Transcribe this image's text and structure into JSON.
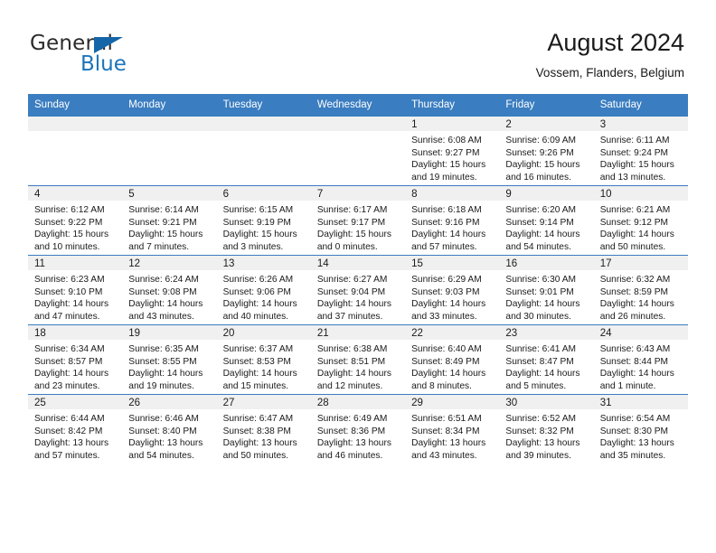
{
  "brand": {
    "name_part1": "General",
    "name_part2": "Blue",
    "triangle_color": "#1566a8",
    "blue_color": "#1b75bb"
  },
  "header": {
    "title": "August 2024",
    "subtitle": "Vossem, Flanders, Belgium"
  },
  "theme": {
    "header_row_bg": "#3a7dc0",
    "header_row_text": "#ffffff",
    "daynum_band_bg": "#f0f0f0",
    "grid_line": "#3a7dc0",
    "body_text": "#1a1a1a"
  },
  "weekday_headers": [
    "Sunday",
    "Monday",
    "Tuesday",
    "Wednesday",
    "Thursday",
    "Friday",
    "Saturday"
  ],
  "weeks": [
    [
      {
        "day": "",
        "lines": []
      },
      {
        "day": "",
        "lines": []
      },
      {
        "day": "",
        "lines": []
      },
      {
        "day": "",
        "lines": []
      },
      {
        "day": "1",
        "lines": [
          "Sunrise: 6:08 AM",
          "Sunset: 9:27 PM",
          "Daylight: 15 hours",
          "and 19 minutes."
        ]
      },
      {
        "day": "2",
        "lines": [
          "Sunrise: 6:09 AM",
          "Sunset: 9:26 PM",
          "Daylight: 15 hours",
          "and 16 minutes."
        ]
      },
      {
        "day": "3",
        "lines": [
          "Sunrise: 6:11 AM",
          "Sunset: 9:24 PM",
          "Daylight: 15 hours",
          "and 13 minutes."
        ]
      }
    ],
    [
      {
        "day": "4",
        "lines": [
          "Sunrise: 6:12 AM",
          "Sunset: 9:22 PM",
          "Daylight: 15 hours",
          "and 10 minutes."
        ]
      },
      {
        "day": "5",
        "lines": [
          "Sunrise: 6:14 AM",
          "Sunset: 9:21 PM",
          "Daylight: 15 hours",
          "and 7 minutes."
        ]
      },
      {
        "day": "6",
        "lines": [
          "Sunrise: 6:15 AM",
          "Sunset: 9:19 PM",
          "Daylight: 15 hours",
          "and 3 minutes."
        ]
      },
      {
        "day": "7",
        "lines": [
          "Sunrise: 6:17 AM",
          "Sunset: 9:17 PM",
          "Daylight: 15 hours",
          "and 0 minutes."
        ]
      },
      {
        "day": "8",
        "lines": [
          "Sunrise: 6:18 AM",
          "Sunset: 9:16 PM",
          "Daylight: 14 hours",
          "and 57 minutes."
        ]
      },
      {
        "day": "9",
        "lines": [
          "Sunrise: 6:20 AM",
          "Sunset: 9:14 PM",
          "Daylight: 14 hours",
          "and 54 minutes."
        ]
      },
      {
        "day": "10",
        "lines": [
          "Sunrise: 6:21 AM",
          "Sunset: 9:12 PM",
          "Daylight: 14 hours",
          "and 50 minutes."
        ]
      }
    ],
    [
      {
        "day": "11",
        "lines": [
          "Sunrise: 6:23 AM",
          "Sunset: 9:10 PM",
          "Daylight: 14 hours",
          "and 47 minutes."
        ]
      },
      {
        "day": "12",
        "lines": [
          "Sunrise: 6:24 AM",
          "Sunset: 9:08 PM",
          "Daylight: 14 hours",
          "and 43 minutes."
        ]
      },
      {
        "day": "13",
        "lines": [
          "Sunrise: 6:26 AM",
          "Sunset: 9:06 PM",
          "Daylight: 14 hours",
          "and 40 minutes."
        ]
      },
      {
        "day": "14",
        "lines": [
          "Sunrise: 6:27 AM",
          "Sunset: 9:04 PM",
          "Daylight: 14 hours",
          "and 37 minutes."
        ]
      },
      {
        "day": "15",
        "lines": [
          "Sunrise: 6:29 AM",
          "Sunset: 9:03 PM",
          "Daylight: 14 hours",
          "and 33 minutes."
        ]
      },
      {
        "day": "16",
        "lines": [
          "Sunrise: 6:30 AM",
          "Sunset: 9:01 PM",
          "Daylight: 14 hours",
          "and 30 minutes."
        ]
      },
      {
        "day": "17",
        "lines": [
          "Sunrise: 6:32 AM",
          "Sunset: 8:59 PM",
          "Daylight: 14 hours",
          "and 26 minutes."
        ]
      }
    ],
    [
      {
        "day": "18",
        "lines": [
          "Sunrise: 6:34 AM",
          "Sunset: 8:57 PM",
          "Daylight: 14 hours",
          "and 23 minutes."
        ]
      },
      {
        "day": "19",
        "lines": [
          "Sunrise: 6:35 AM",
          "Sunset: 8:55 PM",
          "Daylight: 14 hours",
          "and 19 minutes."
        ]
      },
      {
        "day": "20",
        "lines": [
          "Sunrise: 6:37 AM",
          "Sunset: 8:53 PM",
          "Daylight: 14 hours",
          "and 15 minutes."
        ]
      },
      {
        "day": "21",
        "lines": [
          "Sunrise: 6:38 AM",
          "Sunset: 8:51 PM",
          "Daylight: 14 hours",
          "and 12 minutes."
        ]
      },
      {
        "day": "22",
        "lines": [
          "Sunrise: 6:40 AM",
          "Sunset: 8:49 PM",
          "Daylight: 14 hours",
          "and 8 minutes."
        ]
      },
      {
        "day": "23",
        "lines": [
          "Sunrise: 6:41 AM",
          "Sunset: 8:47 PM",
          "Daylight: 14 hours",
          "and 5 minutes."
        ]
      },
      {
        "day": "24",
        "lines": [
          "Sunrise: 6:43 AM",
          "Sunset: 8:44 PM",
          "Daylight: 14 hours",
          "and 1 minute."
        ]
      }
    ],
    [
      {
        "day": "25",
        "lines": [
          "Sunrise: 6:44 AM",
          "Sunset: 8:42 PM",
          "Daylight: 13 hours",
          "and 57 minutes."
        ]
      },
      {
        "day": "26",
        "lines": [
          "Sunrise: 6:46 AM",
          "Sunset: 8:40 PM",
          "Daylight: 13 hours",
          "and 54 minutes."
        ]
      },
      {
        "day": "27",
        "lines": [
          "Sunrise: 6:47 AM",
          "Sunset: 8:38 PM",
          "Daylight: 13 hours",
          "and 50 minutes."
        ]
      },
      {
        "day": "28",
        "lines": [
          "Sunrise: 6:49 AM",
          "Sunset: 8:36 PM",
          "Daylight: 13 hours",
          "and 46 minutes."
        ]
      },
      {
        "day": "29",
        "lines": [
          "Sunrise: 6:51 AM",
          "Sunset: 8:34 PM",
          "Daylight: 13 hours",
          "and 43 minutes."
        ]
      },
      {
        "day": "30",
        "lines": [
          "Sunrise: 6:52 AM",
          "Sunset: 8:32 PM",
          "Daylight: 13 hours",
          "and 39 minutes."
        ]
      },
      {
        "day": "31",
        "lines": [
          "Sunrise: 6:54 AM",
          "Sunset: 8:30 PM",
          "Daylight: 13 hours",
          "and 35 minutes."
        ]
      }
    ]
  ]
}
